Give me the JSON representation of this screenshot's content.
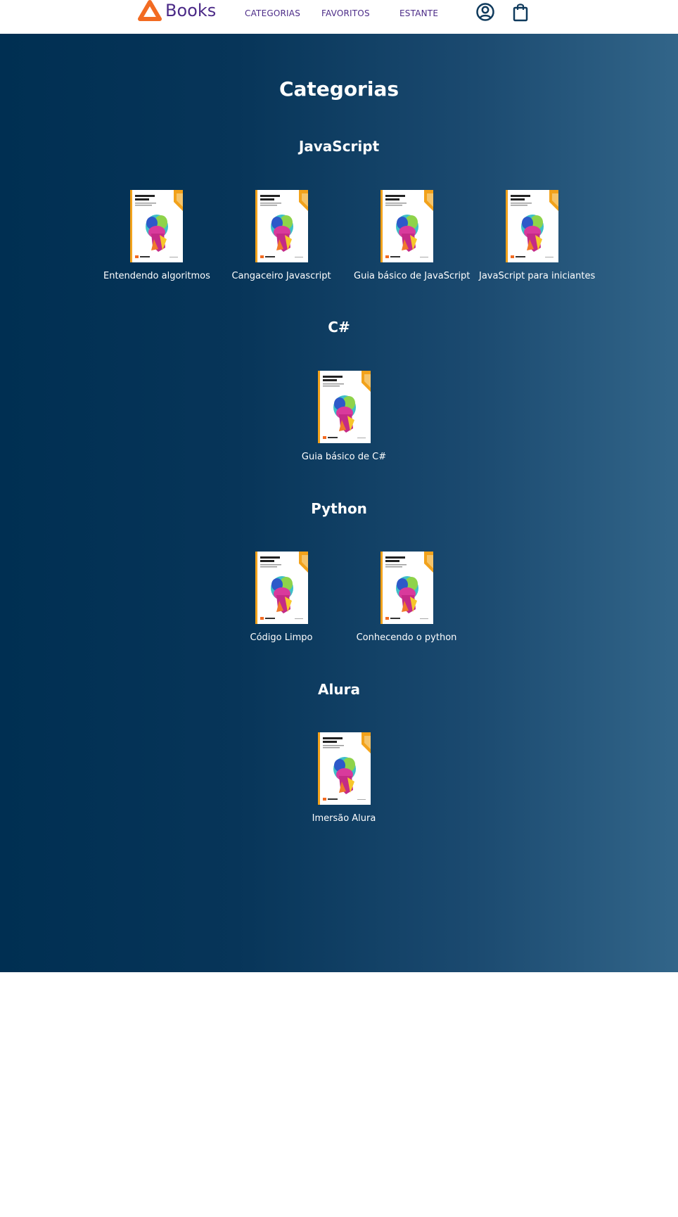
{
  "header": {
    "logo_text": "Books",
    "nav": [
      "CATEGORIAS",
      "FAVORITOS",
      "ESTANTE"
    ],
    "icons": [
      "user-icon",
      "shopping-bag-icon"
    ],
    "colors": {
      "nav_text": "#4b2a87",
      "logo_orange": "#f26b22"
    }
  },
  "main": {
    "title": "Categorias",
    "gradient": [
      "#002f52",
      "#326589"
    ],
    "categories": [
      {
        "name": "JavaScript",
        "books": [
          {
            "title": "Entendendo algoritmos"
          },
          {
            "title": "Cangaceiro Javascript"
          },
          {
            "title": "Guia básico de JavaScript"
          },
          {
            "title": "JavaScript para iniciantes"
          }
        ]
      },
      {
        "name": "C#",
        "books": [
          {
            "title": "Guia básico de C#"
          }
        ]
      },
      {
        "name": "Python",
        "books": [
          {
            "title": "Código Limpo"
          },
          {
            "title": "Conhecendo o python"
          }
        ]
      },
      {
        "name": "Alura",
        "books": [
          {
            "title": "Imersão Alura"
          }
        ]
      }
    ]
  },
  "cover": {
    "title_line1": "Liderança em",
    "title_line2": "Design",
    "icon": "book-cover-image"
  }
}
